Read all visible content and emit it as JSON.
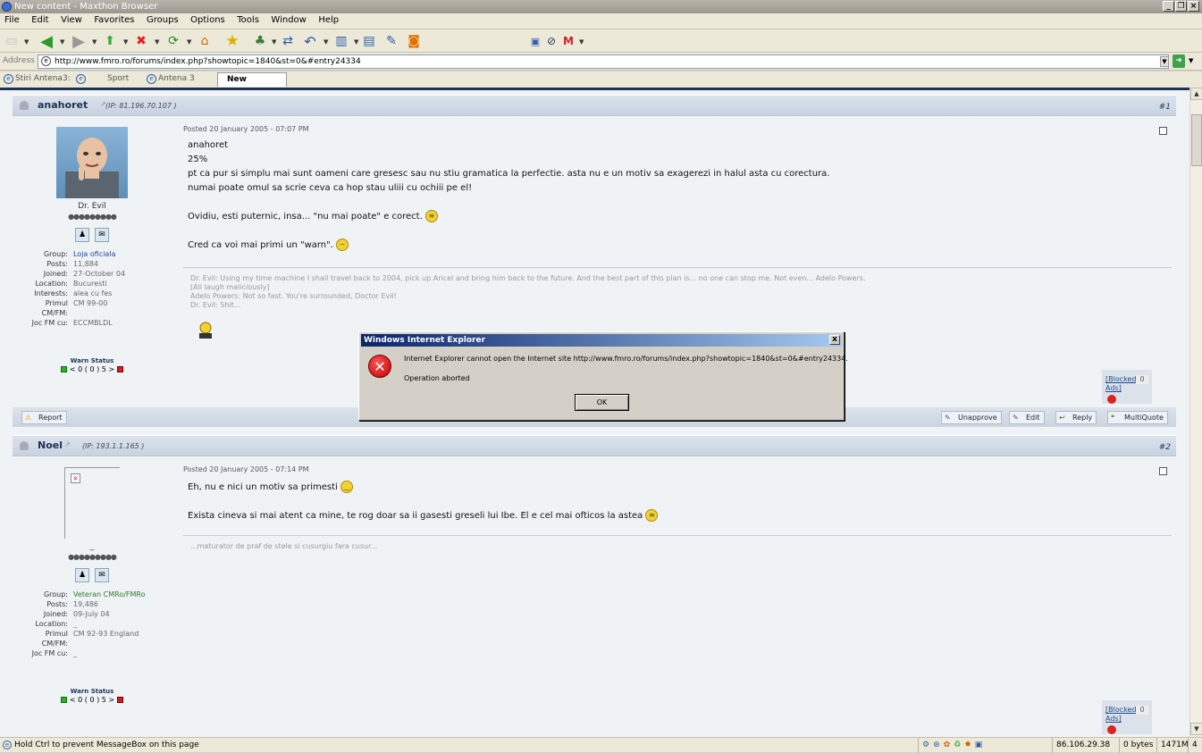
{
  "window": {
    "title": "New content - Maxthon Browser"
  },
  "menu": [
    "File",
    "Edit",
    "View",
    "Favorites",
    "Groups",
    "Options",
    "Tools",
    "Window",
    "Help"
  ],
  "address": {
    "label": "Address",
    "url": "http://www.fmro.ro/forums/index.php?showtopic=1840&st=0&#entry24334"
  },
  "tabs": [
    {
      "label": "Stiri Antena3:"
    },
    {
      "label": "Sport"
    },
    {
      "label": "Antena 3 admi..."
    },
    {
      "label": "New content"
    }
  ],
  "posts": [
    {
      "username": "anahoret",
      "ip": "(IP: 81.196.70.107 )",
      "number": "#1",
      "posted": "Posted 20 January 2005 - 07:07 PM",
      "display_name": "Dr. Evil",
      "pips": "●●●●●●●●●",
      "lines": [
        "anahoret",
        "25%",
        "pt ca pur si simplu mai sunt oameni care gresesc sau nu stiu gramatica la perfectie. asta nu e un motiv sa exagerezi in halul asta cu corectura.",
        "numai poate omul sa scrie ceva ca hop stau uliii cu ochiii pe el!",
        "Ovidiu, esti puternic, insa... \"nu mai poate\" e corect.",
        "Cred ca voi mai primi un \"warn\"."
      ],
      "info": [
        {
          "label": "Group:",
          "value": "Loja oficiala"
        },
        {
          "label": "Posts:",
          "value": "11,884"
        },
        {
          "label": "Joined:",
          "value": "27-October 04"
        },
        {
          "label": "Location:",
          "value": "Bucuresti"
        },
        {
          "label": "Interests:",
          "value": "alea cu fes"
        },
        {
          "label": "Primul",
          "value": "CM 99-00"
        },
        {
          "label": "CM/FM:",
          "value": ""
        },
        {
          "label": "Joc FM cu:",
          "value": "ECCMBLDL"
        }
      ],
      "signature": [
        "Dr. Evil: Using my time machine I shall travel back to 2004, pick up Aricel and bring him back to the future. And the best part of this plan is... no one can stop me. Not even... Adelo Powers.",
        "[All laugh maliciously]",
        "Adelo Powers: Not so fast. You're surrounded, Doctor Evil!",
        "Dr. Evil: Shit..."
      ],
      "warn_label": "Warn Status",
      "warn_value": "< 0 ( 0 ) 5 >"
    },
    {
      "username": "Noel",
      "ip": "(IP: 193.1.1.165 )",
      "number": "#2",
      "posted": "Posted 20 January 2005 - 07:14 PM",
      "display_name": "_",
      "pips": "●●●●●●●●●",
      "lines": [
        "Eh, nu e nici un motiv sa primesti",
        "Exista cineva si mai atent ca mine, te rog doar sa ii gasesti greseli lui Ibe. El e cel mai ofticos la astea"
      ],
      "info": [
        {
          "label": "Group:",
          "value": "Veteran CMRo/FMRo"
        },
        {
          "label": "Posts:",
          "value": "19,486"
        },
        {
          "label": "Joined:",
          "value": "09-July 04"
        },
        {
          "label": "Location:",
          "value": "_"
        },
        {
          "label": "Primul",
          "value": "CM 92-93 England"
        },
        {
          "label": "CM/FM:",
          "value": ""
        },
        {
          "label": "Joc FM cu:",
          "value": "_"
        }
      ],
      "signature": [
        "...maturator de praf de stele si cusurgiu fara cusur..."
      ],
      "warn_label": "Warn Status",
      "warn_value": "< 0 ( 0 ) 5 >"
    }
  ],
  "blocked": {
    "label_line1": "[Blocked",
    "label_line2": "Ads]",
    "count": "0"
  },
  "footer_buttons": {
    "report": "Report",
    "unapprove": "Unapprove",
    "edit": "Edit",
    "reply": "Reply",
    "multiquote": "MultiQuote"
  },
  "dialog": {
    "title": "Windows Internet Explorer",
    "message": "Internet Explorer cannot open the Internet site http://www.fmro.ro/forums/index.php?showtopic=1840&st=0&#entry24334.",
    "sub": "Operation aborted",
    "ok": "OK",
    "close": "x"
  },
  "status": {
    "message": "Hold Ctrl to prevent MessageBox on this page",
    "ip": "86.106.29.38",
    "bytes": "0 bytes",
    "memory": "1471M",
    "count": "4"
  }
}
